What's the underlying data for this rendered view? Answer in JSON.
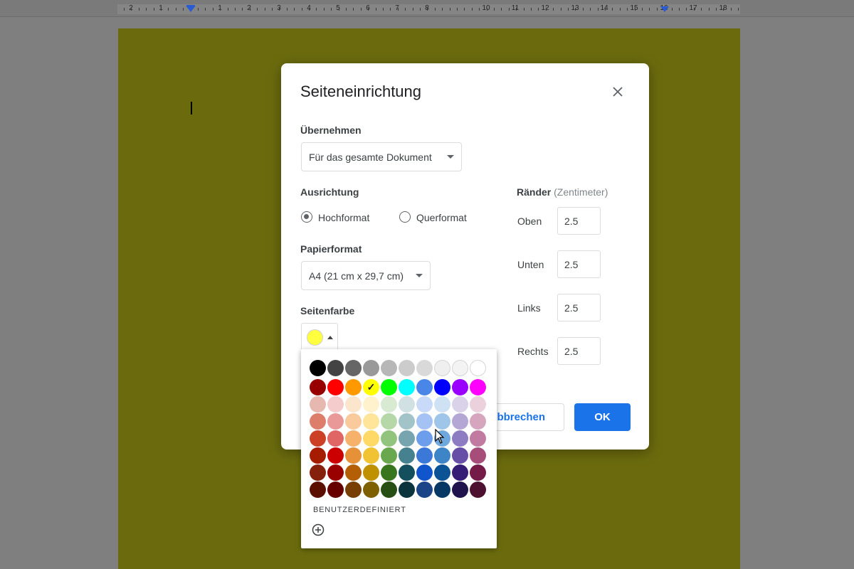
{
  "ruler": {
    "numbers": [
      "2",
      "1",
      "1",
      "2",
      "3",
      "4",
      "5",
      "6",
      "7",
      "8",
      "10",
      "11",
      "12",
      "13",
      "14",
      "15",
      "16",
      "17",
      "18"
    ]
  },
  "dialog": {
    "title": "Seiteneinrichtung",
    "apply": {
      "label": "Übernehmen",
      "value": "Für das gesamte Dokument"
    },
    "orientation": {
      "label": "Ausrichtung",
      "options": [
        "Hochformat",
        "Querformat"
      ],
      "selected": "Hochformat"
    },
    "paper": {
      "label": "Papierformat",
      "value": "A4 (21 cm x 29,7 cm)"
    },
    "page_color": {
      "label": "Seitenfarbe",
      "selected_color": "#ffff3f"
    },
    "margins": {
      "label": "Ränder",
      "unit": "(Zentimeter)",
      "items": [
        {
          "label": "Oben",
          "value": "2.5"
        },
        {
          "label": "Unten",
          "value": "2.5"
        },
        {
          "label": "Links",
          "value": "2.5"
        },
        {
          "label": "Rechts",
          "value": "2.5"
        }
      ]
    },
    "buttons": {
      "cancel": "Abbrechen",
      "ok": "OK"
    }
  },
  "palette": {
    "custom_label": "BENUTZERDEFINIERT",
    "selected": "#ffff00",
    "rows": [
      [
        "#000000",
        "#434343",
        "#666666",
        "#999999",
        "#b7b7b7",
        "#cccccc",
        "#d9d9d9",
        "#efefef",
        "#f3f3f3",
        "#ffffff"
      ],
      [
        "#980000",
        "#ff0000",
        "#ff9900",
        "#ffff00",
        "#00ff00",
        "#00ffff",
        "#4a86e8",
        "#0000ff",
        "#9900ff",
        "#ff00ff"
      ],
      [
        "#e6b8af",
        "#f4cccc",
        "#fce5cd",
        "#fff2cc",
        "#d9ead3",
        "#d0e0e3",
        "#c9daf8",
        "#cfe2f3",
        "#d9d2e9",
        "#ead1dc"
      ],
      [
        "#dd7e6b",
        "#ea9999",
        "#f9cb9c",
        "#ffe599",
        "#b6d7a8",
        "#a2c4c9",
        "#a4c2f4",
        "#9fc5e8",
        "#b4a7d6",
        "#d5a6bd"
      ],
      [
        "#cc4125",
        "#e06666",
        "#f6b26b",
        "#ffd966",
        "#93c47d",
        "#76a5af",
        "#6d9eeb",
        "#6fa8dc",
        "#8e7cc3",
        "#c27ba0"
      ],
      [
        "#a61c00",
        "#cc0000",
        "#e69138",
        "#f1c232",
        "#6aa84f",
        "#45818e",
        "#3c78d8",
        "#3d85c6",
        "#674ea7",
        "#a64d79"
      ],
      [
        "#85200c",
        "#990000",
        "#b45f06",
        "#bf9000",
        "#38761d",
        "#134f5c",
        "#1155cc",
        "#0b5394",
        "#351c75",
        "#741b47"
      ],
      [
        "#5b0f00",
        "#660000",
        "#783f04",
        "#7f6000",
        "#274e13",
        "#0c343d",
        "#1c4587",
        "#073763",
        "#20124d",
        "#4c1130"
      ]
    ]
  }
}
